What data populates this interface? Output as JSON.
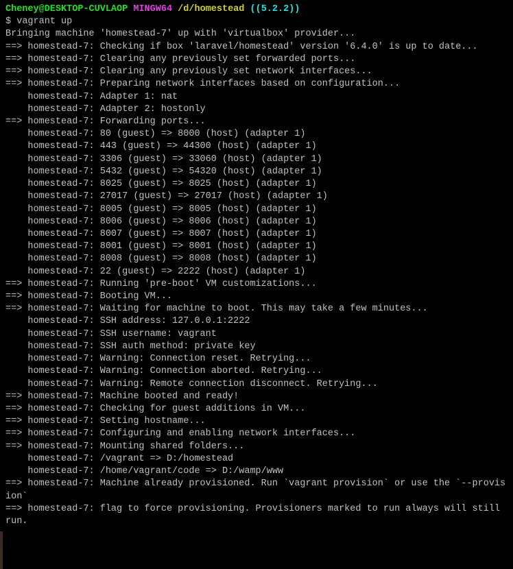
{
  "prompt_line": {
    "user": "Cheney@DESKTOP-CUVLAOP",
    "host": "MINGW64",
    "path": "/d/homestead",
    "branch": "((5.2.2))"
  },
  "prompt_symbol": "$",
  "command": "vagrant up",
  "lines": [
    "Bringing machine 'homestead-7' up with 'virtualbox' provider...",
    "==> homestead-7: Checking if box 'laravel/homestead' version '6.4.0' is up to date...",
    "==> homestead-7: Clearing any previously set forwarded ports...",
    "==> homestead-7: Clearing any previously set network interfaces...",
    "==> homestead-7: Preparing network interfaces based on configuration...",
    "    homestead-7: Adapter 1: nat",
    "    homestead-7: Adapter 2: hostonly",
    "==> homestead-7: Forwarding ports...",
    "    homestead-7: 80 (guest) => 8000 (host) (adapter 1)",
    "    homestead-7: 443 (guest) => 44300 (host) (adapter 1)",
    "    homestead-7: 3306 (guest) => 33060 (host) (adapter 1)",
    "    homestead-7: 5432 (guest) => 54320 (host) (adapter 1)",
    "    homestead-7: 8025 (guest) => 8025 (host) (adapter 1)",
    "    homestead-7: 27017 (guest) => 27017 (host) (adapter 1)",
    "    homestead-7: 8005 (guest) => 8005 (host) (adapter 1)",
    "    homestead-7: 8006 (guest) => 8006 (host) (adapter 1)",
    "    homestead-7: 8007 (guest) => 8007 (host) (adapter 1)",
    "    homestead-7: 8001 (guest) => 8001 (host) (adapter 1)",
    "    homestead-7: 8008 (guest) => 8008 (host) (adapter 1)",
    "    homestead-7: 22 (guest) => 2222 (host) (adapter 1)",
    "==> homestead-7: Running 'pre-boot' VM customizations...",
    "==> homestead-7: Booting VM...",
    "==> homestead-7: Waiting for machine to boot. This may take a few minutes...",
    "    homestead-7: SSH address: 127.0.0.1:2222",
    "    homestead-7: SSH username: vagrant",
    "    homestead-7: SSH auth method: private key",
    "    homestead-7: Warning: Connection reset. Retrying...",
    "    homestead-7: Warning: Connection aborted. Retrying...",
    "    homestead-7: Warning: Remote connection disconnect. Retrying...",
    "==> homestead-7: Machine booted and ready!",
    "==> homestead-7: Checking for guest additions in VM...",
    "==> homestead-7: Setting hostname...",
    "==> homestead-7: Configuring and enabling network interfaces...",
    "==> homestead-7: Mounting shared folders...",
    "    homestead-7: /vagrant => D:/homestead",
    "    homestead-7: /home/vagrant/code => D:/wamp/www",
    "==> homestead-7: Machine already provisioned. Run `vagrant provision` or use the `--provision`",
    "==> homestead-7: flag to force provisioning. Provisioners marked to run always will still run."
  ]
}
